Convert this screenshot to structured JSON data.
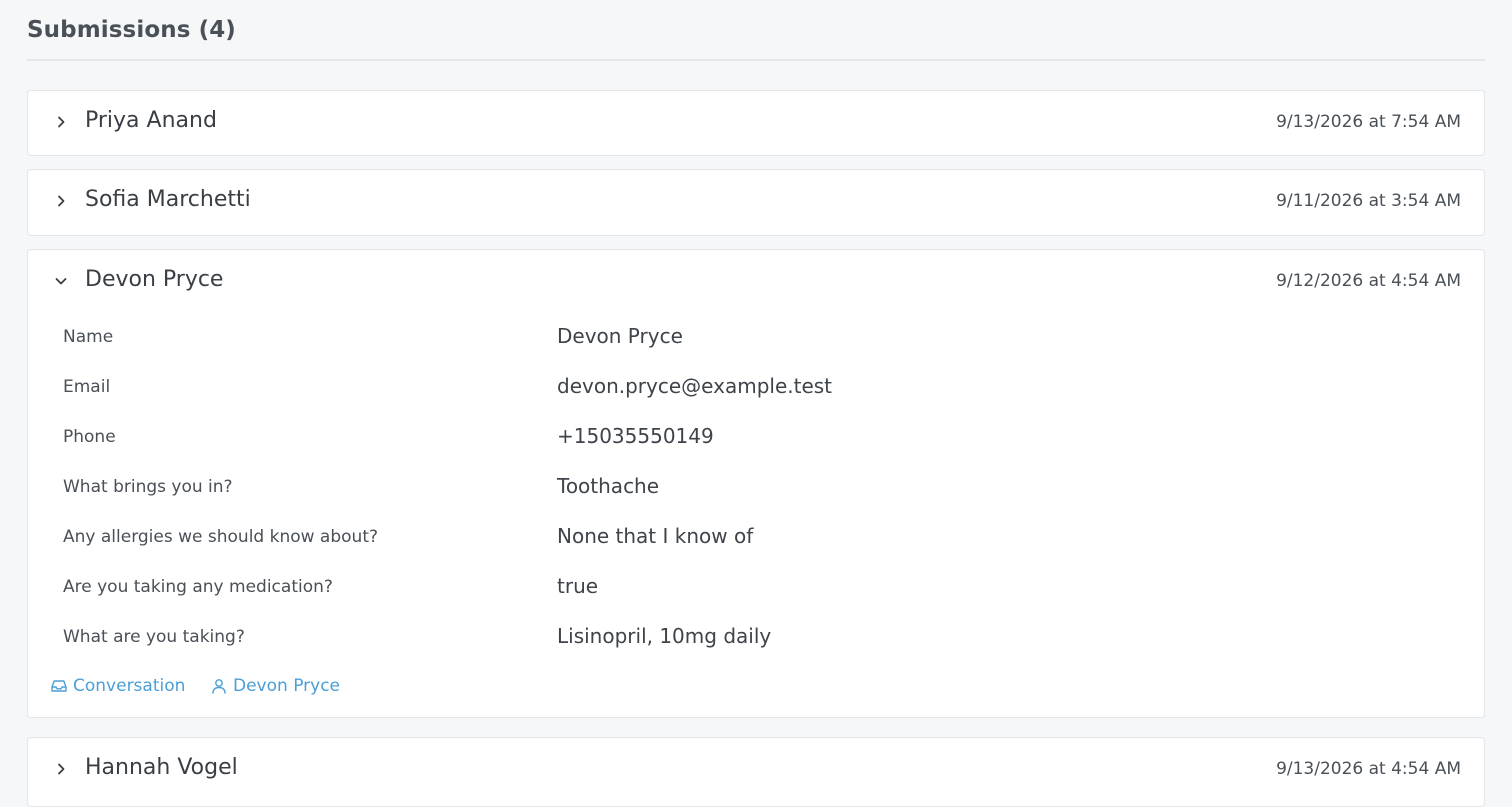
{
  "heading": {
    "title": "Submissions (4)"
  },
  "submissions": [
    {
      "name": "Priya Anand",
      "date": "9/13/2026 at 7:54 AM",
      "expanded": false
    },
    {
      "name": "Sofia Marchetti",
      "date": "9/11/2026 at 3:54 AM",
      "expanded": false
    },
    {
      "name": "Devon Pryce",
      "date": "9/12/2026 at 4:54 AM",
      "expanded": true,
      "fields": [
        {
          "label": "Name",
          "value": "Devon Pryce"
        },
        {
          "label": "Email",
          "value": "devon.pryce@example.test"
        },
        {
          "label": "Phone",
          "value": "+15035550149"
        },
        {
          "label": "What brings you in?",
          "value": "Toothache"
        },
        {
          "label": "Any allergies we should know about?",
          "value": "None that I know of"
        },
        {
          "label": "Are you taking any medication?",
          "value": "true"
        },
        {
          "label": "What are you taking?",
          "value": "Lisinopril, 10mg daily"
        }
      ],
      "links": {
        "conversation": {
          "label": "Conversation",
          "icon": "inbox-icon"
        },
        "contact": {
          "label": "Devon Pryce",
          "icon": "user-icon"
        }
      }
    },
    {
      "name": "Hannah Vogel",
      "date": "9/13/2026 at 4:54 AM",
      "expanded": false
    }
  ],
  "colors": {
    "background": "#f5f7f9",
    "card": "#ffffff",
    "border": "#e2e6ea",
    "link": "#4a9fd8",
    "text": "#3c4248"
  }
}
